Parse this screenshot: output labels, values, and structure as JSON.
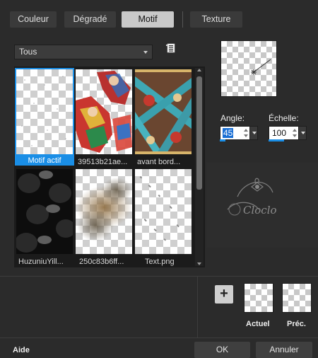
{
  "tabs": [
    {
      "label": "Couleur"
    },
    {
      "label": "Dégradé"
    },
    {
      "label": "Motif"
    },
    {
      "label": "Texture"
    }
  ],
  "active_tab": "Motif",
  "category_dropdown": {
    "value": "Tous"
  },
  "gallery": {
    "items": [
      {
        "label": "Motif actif",
        "selected": true
      },
      {
        "label": "39513b21ae..."
      },
      {
        "label": "avant bord..."
      },
      {
        "label": "HuzuniuYill..."
      },
      {
        "label": "250c83b6ff..."
      },
      {
        "label": "Text.png"
      }
    ]
  },
  "angle": {
    "label": "Angle:",
    "value": "45"
  },
  "scale": {
    "label": "Échelle:",
    "value": "100"
  },
  "watermark": {
    "text": "Cloclo"
  },
  "swatches": {
    "current_label": "Actuel",
    "previous_label": "Préc."
  },
  "add_button": {
    "label": "+"
  },
  "footer": {
    "help_label": "Aide",
    "ok_label": "OK",
    "cancel_label": "Annuler"
  },
  "colors": {
    "accent": "#1a8ee6",
    "background": "#2b2b2b",
    "active_tab": "#c9c9c9"
  }
}
